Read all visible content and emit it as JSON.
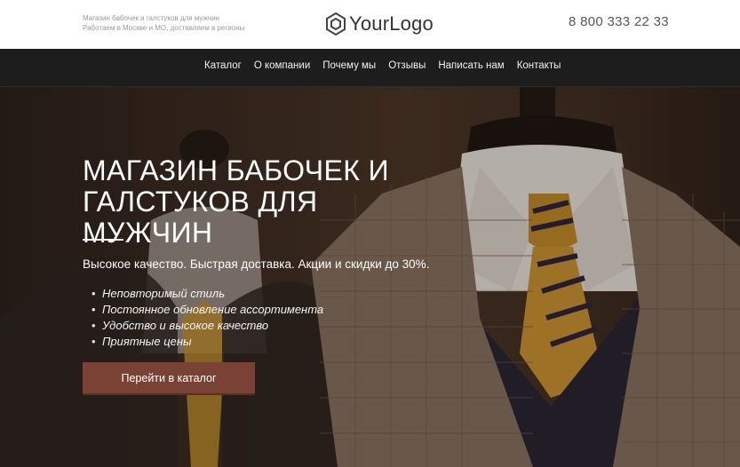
{
  "header": {
    "tagline_line1": "Магазин бабочек и галстуков для мужчин",
    "tagline_line2": "Работаем в Москве и МО, доставляем в регионы",
    "logo_text": "YourLogo",
    "phone": "8 800 333 22 33"
  },
  "nav": {
    "items": [
      {
        "label": "Каталог"
      },
      {
        "label": "О компании"
      },
      {
        "label": "Почему мы"
      },
      {
        "label": "Отзывы"
      },
      {
        "label": "Написать нам"
      },
      {
        "label": "Контакты"
      }
    ]
  },
  "hero": {
    "title": "МАГАЗИН БАБОЧЕК И ГАЛСТУКОВ ДЛЯ МУЖЧИН",
    "subtitle": "Высокое качество. Быстрая доставка. Акции и скидки до 30%.",
    "features": [
      "Неповторимый стиль",
      "Постоянное обновление ассортимента",
      "Удобство и высокое качество",
      "Приятные цены"
    ],
    "cta_label": "Перейти в каталог"
  },
  "colors": {
    "nav_bg": "#1d1d1d",
    "cta_bg": "#7a4234",
    "hero_bg": "#3a2c22"
  }
}
